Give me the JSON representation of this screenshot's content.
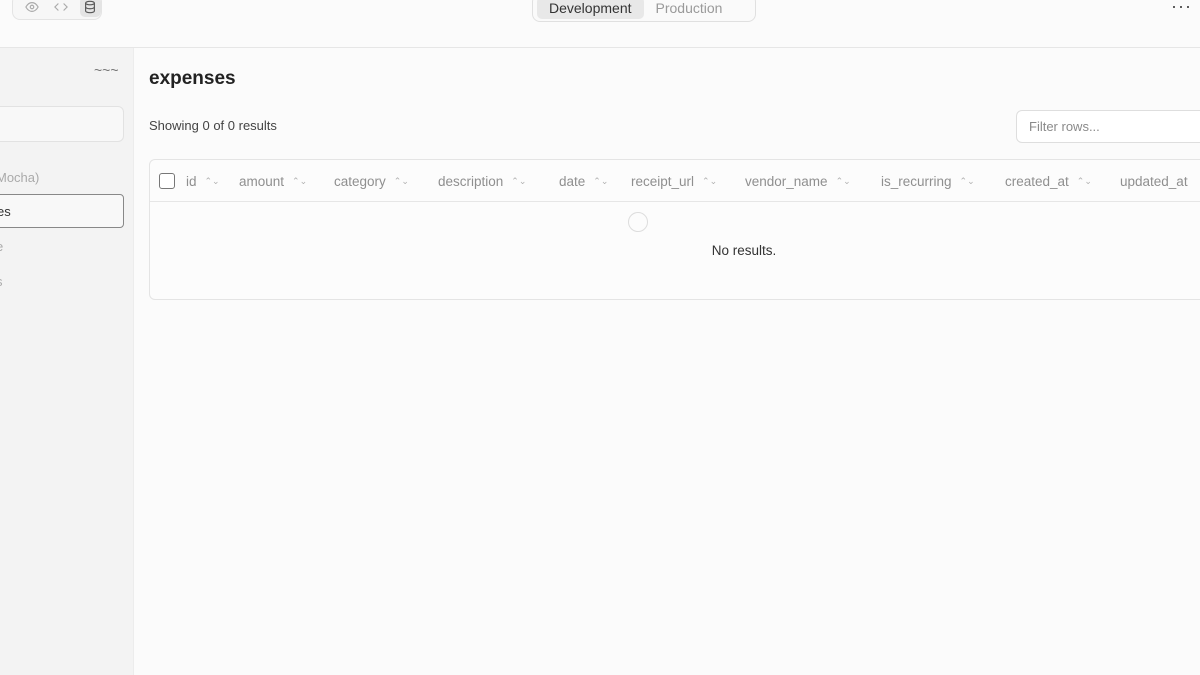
{
  "topbar": {
    "view_icons": [
      "eye-icon",
      "code-icon",
      "database-icon"
    ],
    "environments": [
      {
        "label": "Development",
        "active": true
      },
      {
        "label": "Production",
        "active": false
      }
    ],
    "more_label": "···"
  },
  "sidebar": {
    "more_label": "~~~",
    "search_text": "",
    "items": [
      {
        "label": "Mocha)",
        "active": false
      },
      {
        "label": "es",
        "active": true
      },
      {
        "label": "e",
        "active": false
      },
      {
        "label": "s",
        "active": false
      }
    ]
  },
  "main": {
    "title": "expenses",
    "result_count": "Showing 0 of 0 results",
    "filter_placeholder": "Filter rows...",
    "columns": [
      "id",
      "amount",
      "category",
      "description",
      "date",
      "receipt_url",
      "vendor_name",
      "is_recurring",
      "created_at",
      "updated_at"
    ],
    "sort_glyph": "⌃⌄",
    "empty_message": "No results."
  }
}
